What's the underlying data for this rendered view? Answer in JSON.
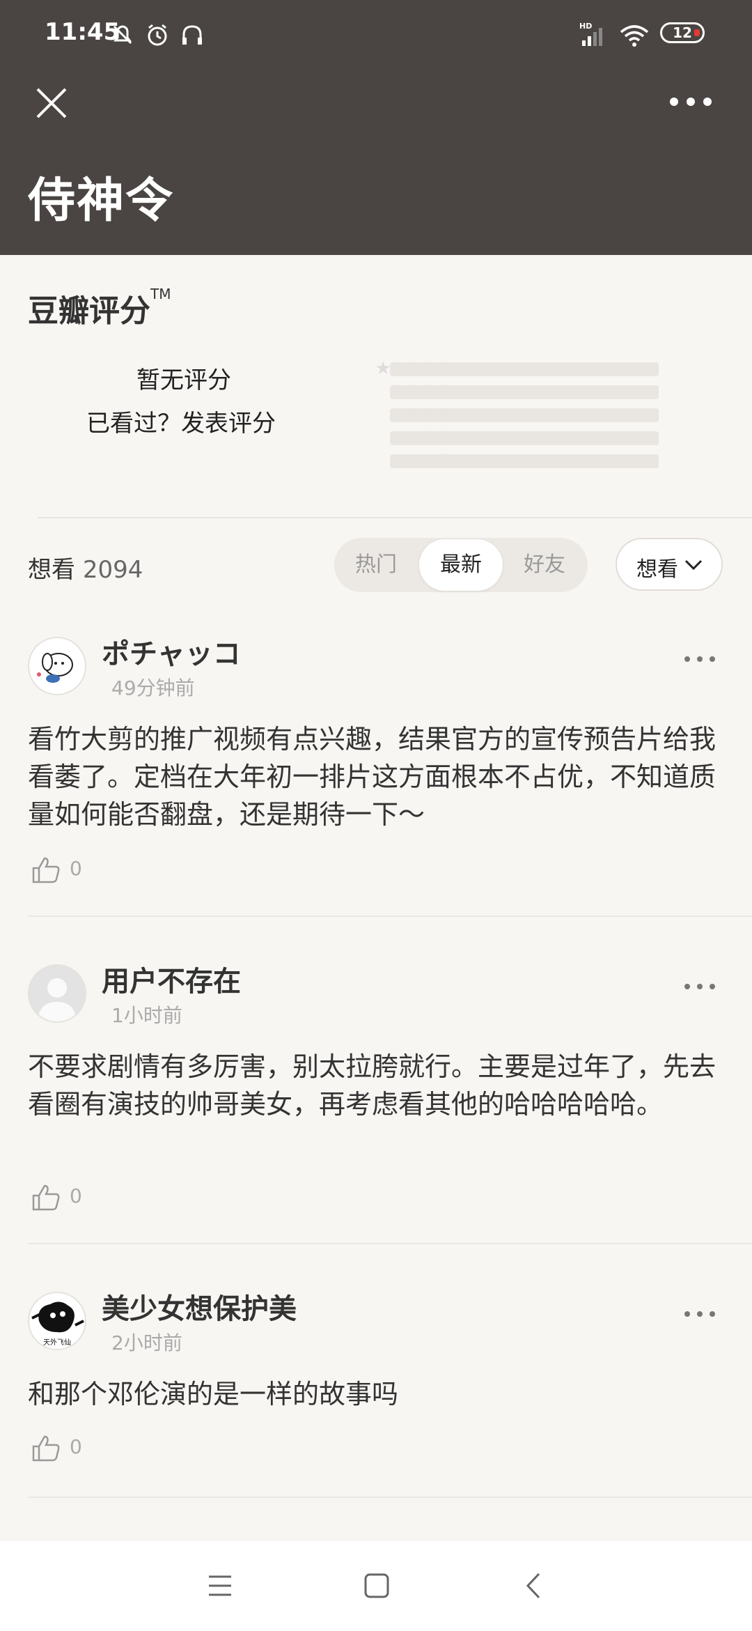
{
  "status_bar": {
    "time": "11:45",
    "battery": "12"
  },
  "header": {
    "title": "侍神令"
  },
  "rating": {
    "brand": "豆瓣评分",
    "tm": "TM",
    "no_rating": "暂无评分",
    "rate_prompt": "已看过？发表评分",
    "distribution": [
      {
        "stars": "★★★★★",
        "fraction": 0
      },
      {
        "stars": "★★★★",
        "fraction": 0
      },
      {
        "stars": "★★★",
        "fraction": 0
      },
      {
        "stars": "★★",
        "fraction": 0
      },
      {
        "stars": "★",
        "fraction": 0
      }
    ]
  },
  "filter": {
    "want_label": "想看",
    "want_count": "2094",
    "tabs": [
      "热门",
      "最新",
      "好友"
    ],
    "active_tab": "最新",
    "dropdown": "想看"
  },
  "comments": [
    {
      "user": "ポチャッコ",
      "time": "49分钟前",
      "text": "看竹大剪的推广视频有点兴趣，结果官方的宣传预告片给我看萎了。定档在大年初一排片这方面根本不占优，不知道质量如何能否翻盘，还是期待一下～",
      "likes": "0"
    },
    {
      "user": "用户不存在",
      "time": "1小时前",
      "text": "不要求剧情有多厉害，别太拉胯就行。主要是过年了，先去看圈有演技的帅哥美女，再考虑看其他的哈哈哈哈哈。",
      "likes": "0"
    },
    {
      "user": "美少女想保护美",
      "time": "2小时前",
      "text": "和那个邓伦演的是一样的故事吗",
      "likes": "0",
      "avatar_caption": "天外飞仙"
    }
  ]
}
